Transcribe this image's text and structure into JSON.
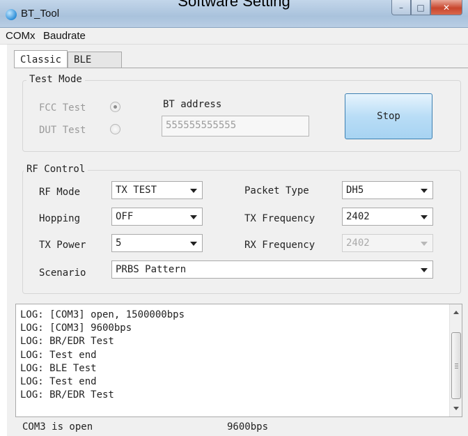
{
  "caption": "Software Setting",
  "window": {
    "title": "BT_Tool",
    "controls": {
      "minimize": "–",
      "maximize": "□",
      "close": "✕"
    }
  },
  "menu": [
    "COMx",
    "Baudrate"
  ],
  "tabs": [
    {
      "label": "Classic",
      "active": true
    },
    {
      "label": "BLE",
      "active": false
    }
  ],
  "test_mode": {
    "title": "Test Mode",
    "fcc_label": "FCC Test",
    "fcc_checked": true,
    "dut_label": "DUT Test",
    "dut_checked": false,
    "bt_address_label": "BT address",
    "bt_address_value": "555555555555",
    "stop_button": "Stop"
  },
  "rf_control": {
    "title": "RF Control",
    "rf_mode_label": "RF Mode",
    "rf_mode_value": "TX TEST",
    "hopping_label": "Hopping",
    "hopping_value": "OFF",
    "tx_power_label": "TX Power",
    "tx_power_value": "5",
    "packet_type_label": "Packet Type",
    "packet_type_value": "DH5",
    "tx_frequency_label": "TX Frequency",
    "tx_frequency_value": "2402",
    "rx_frequency_label": "RX Frequency",
    "rx_frequency_value": "2402",
    "scenario_label": "Scenario",
    "scenario_value": "PRBS Pattern"
  },
  "log": [
    "LOG: [COM3] open, 1500000bps",
    "LOG: [COM3] 9600bps",
    "LOG: BR/EDR Test",
    "LOG: Test end",
    "LOG: BLE Test",
    "LOG: Test end",
    "LOG: BR/EDR Test"
  ],
  "status": {
    "port": "COM3 is open",
    "baud": "9600bps"
  },
  "icons": [
    "app-icon",
    "chevron-down-icon",
    "scroll-up-icon",
    "scroll-down-icon"
  ]
}
